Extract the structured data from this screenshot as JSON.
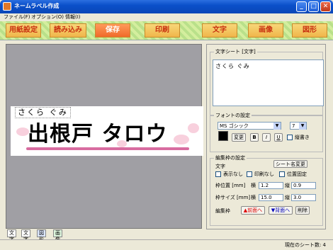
{
  "window": {
    "title": "ネームラベル作成",
    "minimize": "_",
    "maximize": "□",
    "close": "✕"
  },
  "menu": [
    "ファイル(F)",
    "オプション(O)",
    "情報(I)"
  ],
  "toolbar": [
    "用紙設定",
    "読み込み",
    "保存",
    "印刷",
    "文字",
    "画像",
    "図形"
  ],
  "label": {
    "small_text": "さくら ぐみ",
    "big_text": "出根戸 タロウ"
  },
  "bottom_tabs": [
    "文字",
    "文字",
    "図形",
    "画像"
  ],
  "status": "現在のシート数: 4",
  "text_sheet": {
    "title": "文字シート [文字]",
    "content": "さくら ぐみ"
  },
  "font": {
    "title": "フォントの設定",
    "name": "MS ゴシック",
    "size": "7",
    "change": "変更",
    "bold": "B",
    "italic": "I",
    "underline": "U",
    "vertical": "縦書き"
  },
  "edit_frame": {
    "title": "編集枠の設定",
    "kind": "文字",
    "rename": "シート名変更",
    "hide": "表示なし",
    "noprint": "印刷なし",
    "lock": "位置固定",
    "pos_label": "枠位置 [mm]",
    "size_label": "枠サイズ [mm]",
    "x": "横",
    "y": "縦",
    "pos_x": "1.2",
    "pos_y": "0.9",
    "size_x": "15.0",
    "size_y": "3.0",
    "frame": "編集枠",
    "front": "▲前面へ",
    "back": "▼背面へ",
    "delete": "削除"
  },
  "colors": {
    "accent": "#f06a2a",
    "font_color": "#000000"
  }
}
